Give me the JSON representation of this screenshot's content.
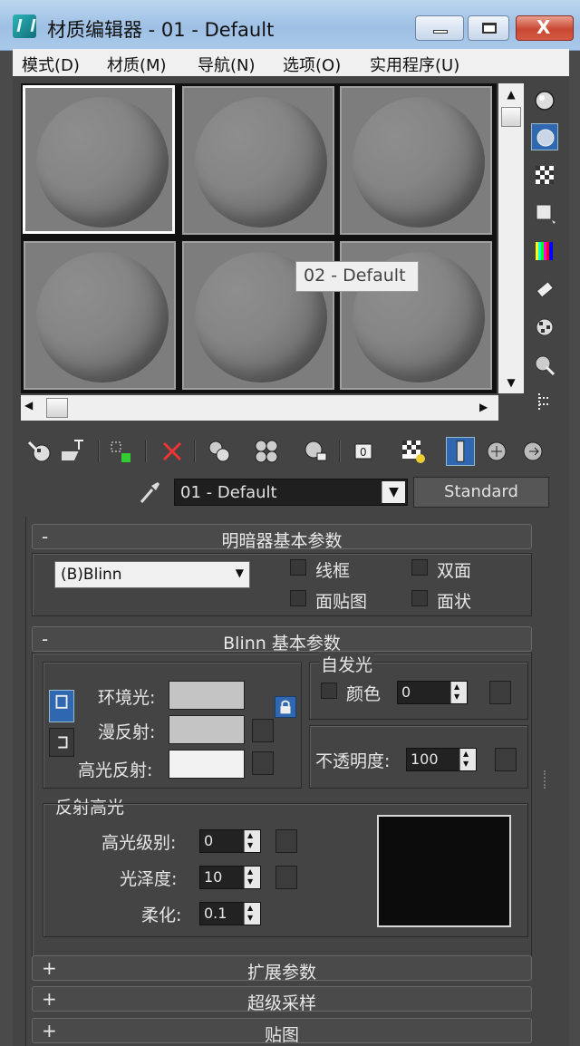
{
  "window": {
    "title": "材质编辑器 - 01 - Default",
    "controls": {
      "minimize": "",
      "maximize": "",
      "close": "X"
    }
  },
  "menu": [
    "模式(D)",
    "材质(M)",
    "导航(N)",
    "选项(O)",
    "实用程序(U)"
  ],
  "sample_slots": {
    "count": 6,
    "active_index": 0,
    "tooltip": "02 - Default"
  },
  "side_toolbar_icons": [
    "sample-type-icon",
    "backlight-icon",
    "background-icon",
    "sample-uv-tiling-icon",
    "video-color-check-icon",
    "make-preview-icon",
    "options-icon",
    "select-by-material-icon",
    "material-map-navigator-icon",
    "dotted-drag-icon"
  ],
  "bottom_toolbar_icons": [
    "get-material-icon",
    "put-to-scene-icon",
    "assign-to-selection-icon",
    "reset-map-icon",
    "make-copy-icon",
    "make-unique-icon",
    "put-to-library-icon",
    "material-id-channel-icon",
    "show-map-in-viewport-icon",
    "show-end-result-icon",
    "go-to-parent-icon",
    "go-forward-to-sibling-icon"
  ],
  "material": {
    "name": "01 - Default",
    "type_button": "Standard"
  },
  "shader_basic": {
    "header": "明暗器基本参数",
    "sign": "-",
    "shader": "(B)Blinn",
    "options": [
      {
        "label": "线框",
        "checked": false
      },
      {
        "label": "双面",
        "checked": false
      },
      {
        "label": "面贴图",
        "checked": false
      },
      {
        "label": "面状",
        "checked": false
      }
    ]
  },
  "blinn_basic": {
    "header": "Blinn 基本参数",
    "sign": "-",
    "ambient_label": "环境光:",
    "diffuse_label": "漫反射:",
    "specular_label": "高光反射:",
    "ambient_color": "#c4c4c4",
    "diffuse_color": "#c4c4c4",
    "specular_color": "#f2f2f2",
    "self_illum": {
      "group_label": "自发光",
      "color_label": "颜色",
      "color_checked": false,
      "value": "0"
    },
    "opacity": {
      "label": "不透明度:",
      "value": "100"
    }
  },
  "specular_highlights": {
    "group_label": "反射高光",
    "level_label": "高光级别:",
    "level": "0",
    "gloss_label": "光泽度:",
    "gloss": "10",
    "soften_label": "柔化:",
    "soften": "0.1"
  },
  "collapsed_rollouts": [
    {
      "sign": "+",
      "label": "扩展参数"
    },
    {
      "sign": "+",
      "label": "超级采样"
    },
    {
      "sign": "+",
      "label": "贴图"
    }
  ]
}
